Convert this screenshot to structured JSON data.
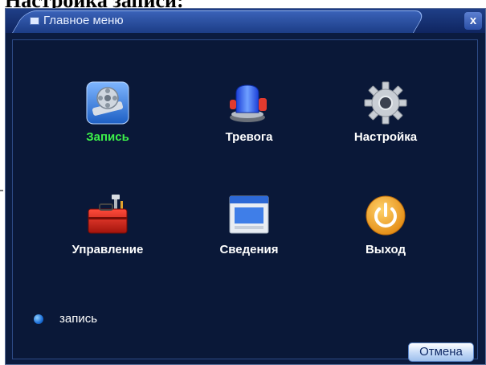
{
  "document": {
    "heading": "Настройка записи:"
  },
  "window": {
    "title": "Главное меню",
    "close_label": "x"
  },
  "menu": {
    "items": [
      {
        "label": "Запись",
        "icon": "record-film-icon",
        "selected": true
      },
      {
        "label": "Тревога",
        "icon": "alarm-siren-icon",
        "selected": false
      },
      {
        "label": "Настройка",
        "icon": "settings-gear-icon",
        "selected": false
      },
      {
        "label": "Управление",
        "icon": "toolbox-icon",
        "selected": false
      },
      {
        "label": "Сведения",
        "icon": "info-window-icon",
        "selected": false
      },
      {
        "label": "Выход",
        "icon": "power-icon",
        "selected": false
      }
    ]
  },
  "status": {
    "text": "запись"
  },
  "footer": {
    "cancel_label": "Отмена"
  },
  "colors": {
    "window_bg": "#0b1b3f",
    "titlebar": "#1c3d86",
    "selected_label": "#3cf04a",
    "label": "#ffffff"
  }
}
